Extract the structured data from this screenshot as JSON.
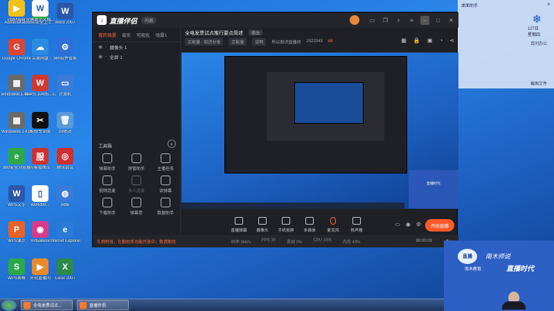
{
  "desktop": {
    "icons": [
      {
        "label": "Administrator",
        "color": "#2f6fd0",
        "glyph": "👤"
      },
      {
        "label": "360安全卫士",
        "color": "#2ca84a",
        "glyph": "+"
      },
      {
        "label": "Word 2007",
        "color": "#2b57a8",
        "glyph": "W"
      },
      {
        "label": "Google Chrome",
        "color": "#db4437",
        "glyph": "G"
      },
      {
        "label": "百度网盘",
        "color": "#2a8ce0",
        "glyph": "☁"
      },
      {
        "label": "360软件管家",
        "color": "#2d6fd6",
        "glyph": "⚙"
      },
      {
        "label": "windows6.1-kb401221...",
        "color": "#6a6a6a",
        "glyph": "▦"
      },
      {
        "label": "W.P.S.10495...12012.201...",
        "color": "#d03a30",
        "glyph": "W"
      },
      {
        "label": "计算机",
        "color": "#3a7ad8",
        "glyph": "▭"
      },
      {
        "label": "Windows6.1-KB947821...",
        "color": "#6a6a6a",
        "glyph": "▦"
      },
      {
        "label": "剪映专业版",
        "color": "#111111",
        "glyph": "✂"
      },
      {
        "label": "回收站",
        "color": "#5a9ad8",
        "glyph": "🗑"
      },
      {
        "label": "360安全浏览器",
        "color": "#2ca84a",
        "glyph": "e"
      },
      {
        "label": "万能看图王",
        "color": "#d03030",
        "glyph": "服"
      },
      {
        "label": "腾讯会议",
        "color": "#d03030",
        "glyph": "◎"
      },
      {
        "label": "WPS文字",
        "color": "#2b57a8",
        "glyph": "W"
      },
      {
        "label": "Wd4d99...",
        "color": "#ffffff",
        "glyph": "▯"
      },
      {
        "label": "网络",
        "color": "#3a7ad8",
        "glyph": "◍"
      },
      {
        "label": "WPS演示",
        "color": "#e8622a",
        "glyph": "P"
      },
      {
        "label": "VirtualBox",
        "color": "#d83a8a",
        "glyph": "◉"
      },
      {
        "label": "Internet Explorer",
        "color": "#2b7ad8",
        "glyph": "e"
      },
      {
        "label": "WPS表格",
        "color": "#2ca84a",
        "glyph": "S"
      },
      {
        "label": "央视直播间",
        "color": "#e88a2a",
        "glyph": "▶"
      },
      {
        "label": "Excel 2007",
        "color": "#2a8a4a",
        "glyph": "X"
      },
      {
        "label": "PotPlayer",
        "color": "#f2c21a",
        "glyph": "▶"
      },
      {
        "label": "全屏显示文档...",
        "color": "#ffffff",
        "glyph": "W"
      }
    ]
  },
  "app": {
    "name": "直播伴侣",
    "badge": "内测",
    "left_tabs": [
      "我的场景",
      "音乐",
      "可视化",
      "场景1"
    ],
    "scenes": [
      {
        "label": "摄像头 1"
      },
      {
        "label": "全屏 1"
      }
    ],
    "toolbox_title": "工具箱",
    "tools": [
      {
        "label": "弹幕助手",
        "dim": false
      },
      {
        "label": "房管助手",
        "dim": false
      },
      {
        "label": "主播任务",
        "dim": false
      },
      {
        "label": "视频连麦",
        "dim": false
      },
      {
        "label": "多人连麦",
        "dim": true
      },
      {
        "label": "读弹幕",
        "dim": false
      },
      {
        "label": "下载助手",
        "dim": false
      },
      {
        "label": "弹幕卷",
        "dim": false
      },
      {
        "label": "数据助手",
        "dim": false
      }
    ],
    "center": {
      "title": "全电发票试点推行要点简述",
      "edit": "修改",
      "sub": [
        "正能量 · 知识分享",
        "正能量",
        "说明",
        "所以知识直播间",
        "2022043",
        "68"
      ],
      "bottom_tools": [
        "直播弹幕",
        "摄像头",
        "手机投屏",
        "多媒体",
        "麦克风",
        "扬声器"
      ],
      "go_live": "开始直播"
    },
    "statusbar": {
      "warn": "礼物特效，在勤助手功能开放中，敬请期待",
      "stats": [
        "码率 0kb/s",
        "FPS 30",
        "丢帧 0%",
        "CPU 15%",
        "内存 43%"
      ],
      "time": "00:00:03"
    },
    "preview": {
      "cam_text": "直播时代"
    }
  },
  "widget": {
    "title": "桌面助手",
    "date": "127日",
    "weekday": "星期四",
    "rows": [
      "百问办公",
      "截图文件"
    ]
  },
  "camera": {
    "logo": "直播",
    "line1": "南木师说",
    "line2": "直播时代",
    "line3": "南木教育"
  },
  "taskbar": {
    "items": [
      "全电发票试点...",
      "直播伴侣"
    ]
  }
}
